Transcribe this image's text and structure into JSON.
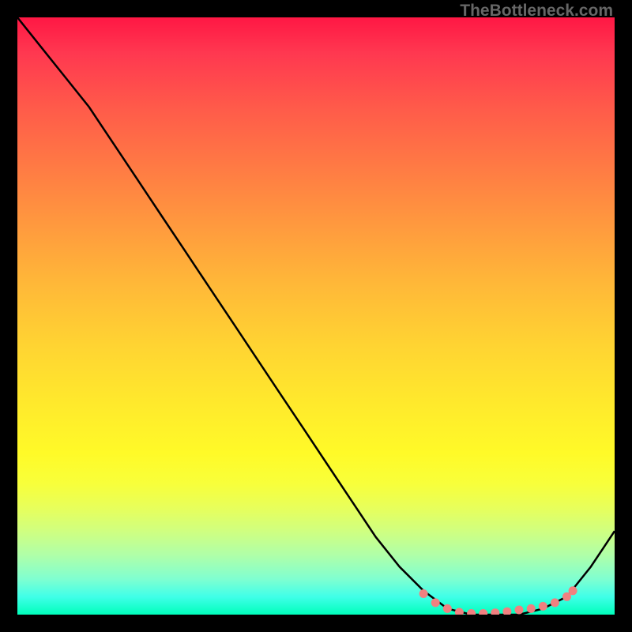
{
  "watermark": "TheBottleneck.com",
  "chart_data": {
    "type": "line",
    "title": "",
    "xlabel": "",
    "ylabel": "",
    "xlim": [
      0,
      100
    ],
    "ylim": [
      0,
      100
    ],
    "curve": {
      "name": "bottleneck-curve",
      "x": [
        0,
        4,
        8,
        12,
        16,
        20,
        24,
        28,
        32,
        36,
        40,
        44,
        48,
        52,
        56,
        60,
        64,
        68,
        72,
        76,
        80,
        84,
        88,
        92,
        96,
        100
      ],
      "y": [
        100,
        95,
        90,
        85,
        79,
        73,
        67,
        61,
        55,
        49,
        43,
        37,
        31,
        25,
        19,
        13,
        8,
        4,
        1,
        0,
        0,
        0,
        1,
        3,
        8,
        14
      ]
    },
    "marker_cluster": {
      "name": "flat-region-markers",
      "color": "#f08080",
      "points": [
        {
          "x": 68,
          "y": 3.5
        },
        {
          "x": 70,
          "y": 2.0
        },
        {
          "x": 72,
          "y": 1.0
        },
        {
          "x": 74,
          "y": 0.4
        },
        {
          "x": 76,
          "y": 0.2
        },
        {
          "x": 78,
          "y": 0.2
        },
        {
          "x": 80,
          "y": 0.3
        },
        {
          "x": 82,
          "y": 0.5
        },
        {
          "x": 84,
          "y": 0.8
        },
        {
          "x": 86,
          "y": 1.0
        },
        {
          "x": 88,
          "y": 1.4
        },
        {
          "x": 90,
          "y": 2.0
        },
        {
          "x": 92,
          "y": 3.0
        },
        {
          "x": 93,
          "y": 4.0
        }
      ]
    },
    "gradient_stops": [
      {
        "pos": 0.0,
        "color": "#ff1744"
      },
      {
        "pos": 0.5,
        "color": "#ffd432"
      },
      {
        "pos": 0.8,
        "color": "#f8ff3a"
      },
      {
        "pos": 1.0,
        "color": "#00ffbb"
      }
    ]
  }
}
